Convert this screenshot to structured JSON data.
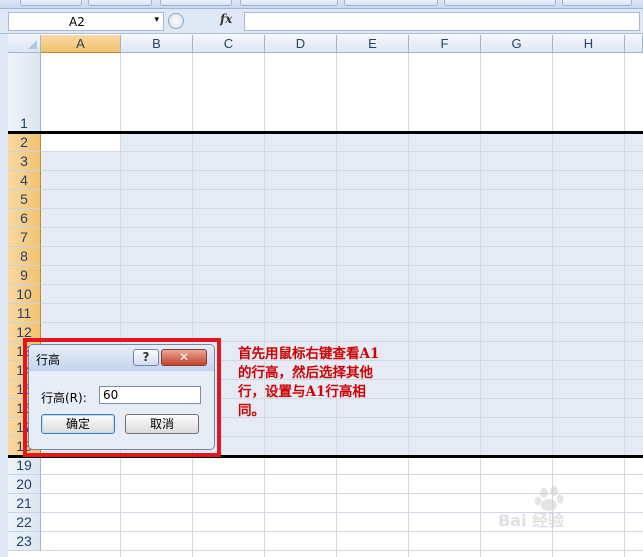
{
  "formula_bar": {
    "name_box_value": "A2",
    "name_box_arrow": "▾",
    "fx_label": "fx",
    "formula_value": ""
  },
  "columns": [
    "A",
    "B",
    "C",
    "D",
    "E",
    "F",
    "G",
    "H"
  ],
  "rows": [
    "1",
    "2",
    "3",
    "4",
    "5",
    "6",
    "7",
    "8",
    "9",
    "10",
    "11",
    "12",
    "13",
    "14",
    "15",
    "16",
    "17",
    "18",
    "19",
    "20",
    "21",
    "22",
    "23"
  ],
  "dialog": {
    "title": "行高",
    "help_label": "?",
    "close_label": "✕",
    "field_label": "行高(R):",
    "field_value": "60",
    "ok_label": "确定",
    "cancel_label": "取消"
  },
  "annotation": "首先用鼠标右键查看A1的行高，然后选择其他行，设置与A1行高相同。",
  "watermark": {
    "text": "Bai 经验"
  },
  "colors": {
    "highlight_frame": "#e3151d",
    "annotation_text": "#d00000",
    "selection_fill": "#e5eaf5"
  }
}
